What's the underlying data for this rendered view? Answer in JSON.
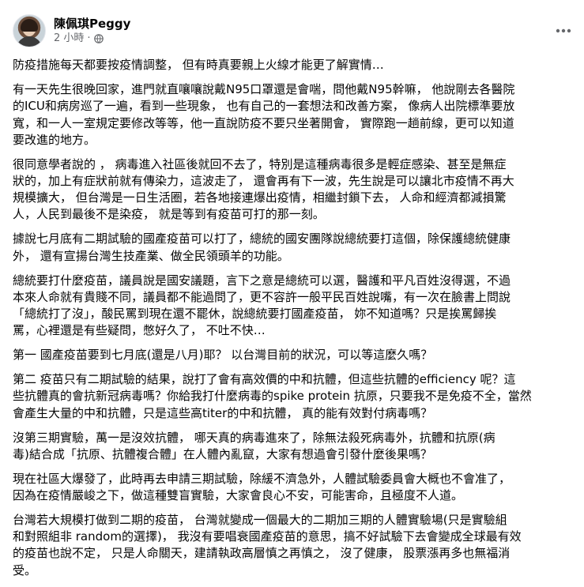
{
  "post": {
    "author": "陳佩琪Peggy",
    "time": "2 小時",
    "separator": "·",
    "privacy_icon": "globe-icon",
    "more_icon": "more-horizontal-icon",
    "paragraphs": [
      "防疫措施每天都要按疫情調整，  但有時真要親上火線才能更了解實情…",
      "    有一天先生很晚回家，進門就直嚷嚷說戴N95口罩還是會喘，問他戴N95幹嘛，  他說剛去各醫院\n的ICU和病房巡了一遍，看到一些現象， 也有自己的一套想法和改善方案，  像病人出院標準要放\n寬，和一人一室規定要修改等等，他一直說防疫不要只坐著開會，  實際跑一趟前線，更可以知道\n要改進的地方。",
      "    很同意學者說的  ，  病毒進入社區後就回不去了，特別是這種病毒很多是輕症感染、甚至是無症\n狀的，加上有症狀前就有傳染力，這波走了，  還會再有下一波，先生說是可以讓北市疫情不再大\n規模擴大，  但台灣是一日生活圈，若各地接連爆出疫情，相繼封鎖下去，  人命和經濟都減損驚\n人，人民到最後不是染疫，  就是等到有疫苗可打的那一刻。",
      "   據說七月底有二期試驗的國產疫苗可以打了，總統的國安團隊說總統要打這個，除保護總統健康\n外，  還有宣揚台灣生技產業、做全民領頭羊的功能。",
      "    總統要打什麼疫苗，議員說是國安議題，言下之意是總統可以選，醫護和平凡百姓沒得選，不過\n本來人命就有貴賤不同，議員都不能過問了，更不容許一般平民百姓說嘴，有一次在臉書上問說\n「總統打了沒」，酸民罵到現在還不罷休，說總統要打國產疫苗，  妳不知道嗎？只是挨罵歸挨\n罵，心裡還是有些疑問，憋好久了，  不吐不快…",
      "    第一  國產疫苗要到七月底(還是八月)耶？  以台灣目前的狀況，可以等這麼久嗎？",
      "    第二  疫苗只有二期試驗的結果，說打了會有高效價的中和抗體，但這些抗體的efficiency 呢？這\n些抗體真的會抗新冠病毒嗎？你給我打什麼病毒的spike protein 抗原，只要我不是免疫不全，當然\n會產生大量的中和抗體，只是這些高titer的中和抗體，  真的能有效對付病毒嗎？",
      "      沒第三期實驗，萬一是沒效抗體，  哪天真的病毒進來了，除無法殺死病毒外，抗體和抗原(病\n毒)結合成「抗原、抗體複合體」在人體內亂竄，大家有想過會引發什麼後果嗎？",
      "    現在社區大爆發了，此時再去申請三期試驗，除緩不濟急外，人體試驗委員會大概也不會准了，\n因為在疫情嚴峻之下，做這種雙盲實驗，大家會良心不安，可能害命，且極度不人道。",
      "    台灣若大規模打做到二期的疫苗，  台灣就變成一個最大的二期加三期的人體實驗場(只是實驗組\n和對照組非 random的選擇)，  我沒有要唱衰國產疫苗的意思，搞不好試驗下去會變成全球最有效\n的疫苗也說不定，  只是人命關天，建請執政高層慎之再慎之，  沒了健康，  股票漲再多也無福消\n受。"
    ]
  }
}
